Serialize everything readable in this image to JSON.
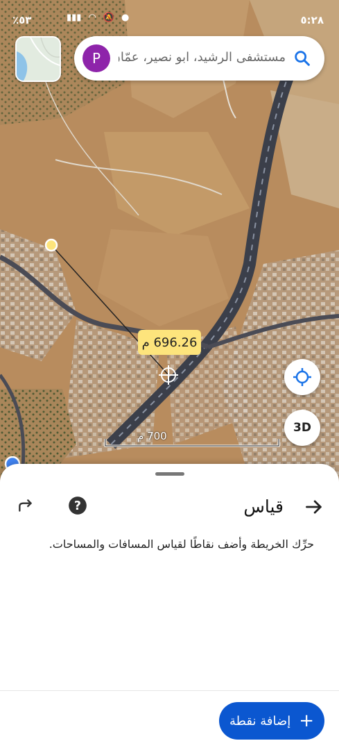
{
  "status_bar": {
    "time": "٥:٢٨",
    "battery": "٪٥٣"
  },
  "search": {
    "avatar_letter": "P",
    "query": "مستشفى الرشيد، ابو نصير، عمّان"
  },
  "map": {
    "measurement": "696.26 م",
    "scale_label": "700 م",
    "btn_3d": "3D"
  },
  "sheet": {
    "title": "قياس",
    "description": "حرِّك الخريطة وأضف نقاطًا لقياس المسافات والمساحات.",
    "add_point_label": "إضافة نقطة",
    "add_point_icon": "+"
  },
  "colors": {
    "accent": "#0b57d0",
    "avatar": "#8e24aa",
    "label_bg": "#fde47c"
  }
}
